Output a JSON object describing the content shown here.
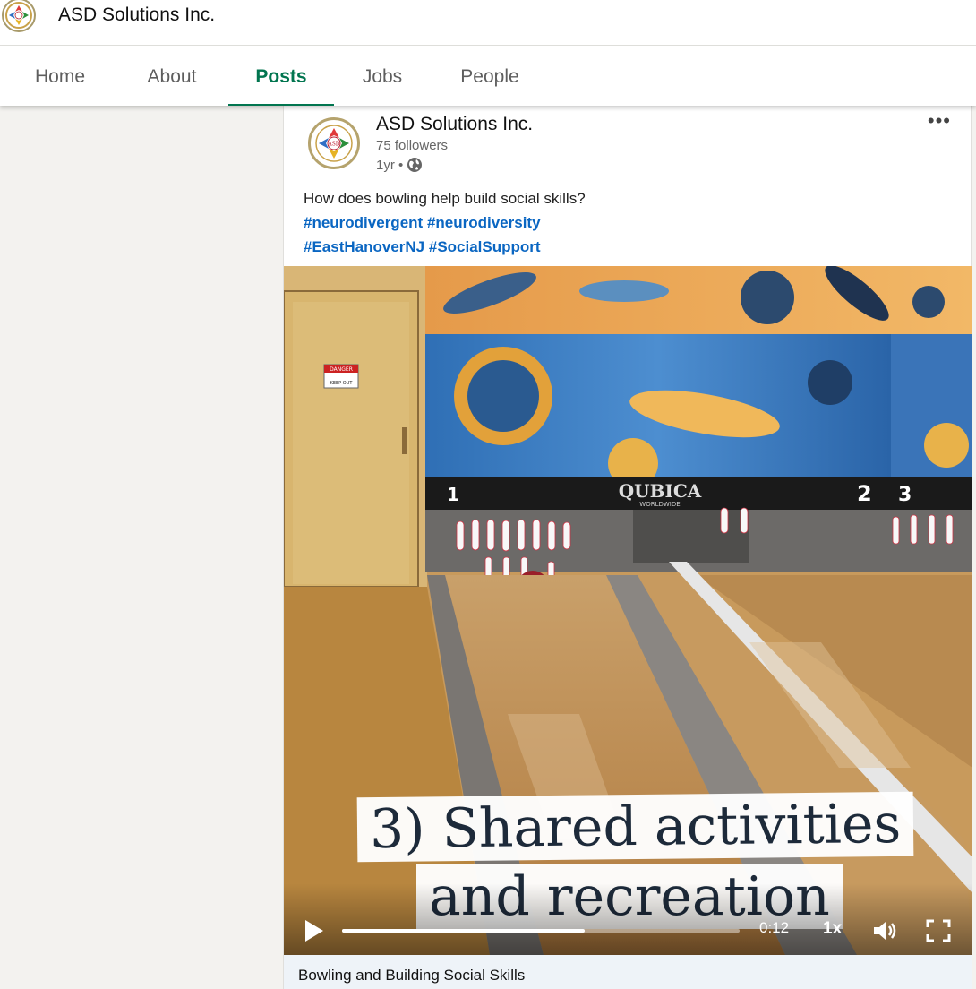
{
  "company": {
    "name": "ASD Solutions Inc.",
    "logo_text": "ASD"
  },
  "tabs": [
    {
      "label": "Home",
      "active": false
    },
    {
      "label": "About",
      "active": false
    },
    {
      "label": "Posts",
      "active": true
    },
    {
      "label": "Jobs",
      "active": false
    },
    {
      "label": "People",
      "active": false
    }
  ],
  "post": {
    "author": "ASD Solutions Inc.",
    "followers": "75 followers",
    "age": "1yr •",
    "visibility_icon": "globe-icon",
    "more_icon": "more-options-icon",
    "text": "How does bowling help build social skills?",
    "hashtags_line1": [
      "#neurodivergent",
      "#neurodiversity"
    ],
    "hashtags_line2": [
      "#EastHanoverNJ",
      "#SocialSupport"
    ]
  },
  "video": {
    "caption_line1": "3) Shared activities",
    "caption_line2": "and recreation",
    "sign_danger": "DANGER",
    "sign_keep_out": "KEEP OUT",
    "brand": "QUBICA",
    "brand_sub": "WORLDWIDE",
    "lane_numbers": [
      "1",
      "2",
      "3"
    ],
    "current_time": "0:12",
    "progress": 0.61,
    "speed": "1x",
    "title": "Bowling and Building Social Skills"
  },
  "colors": {
    "accent": "#01754f",
    "hashtag": "#0a66c2",
    "background": "#f3f2ef"
  }
}
